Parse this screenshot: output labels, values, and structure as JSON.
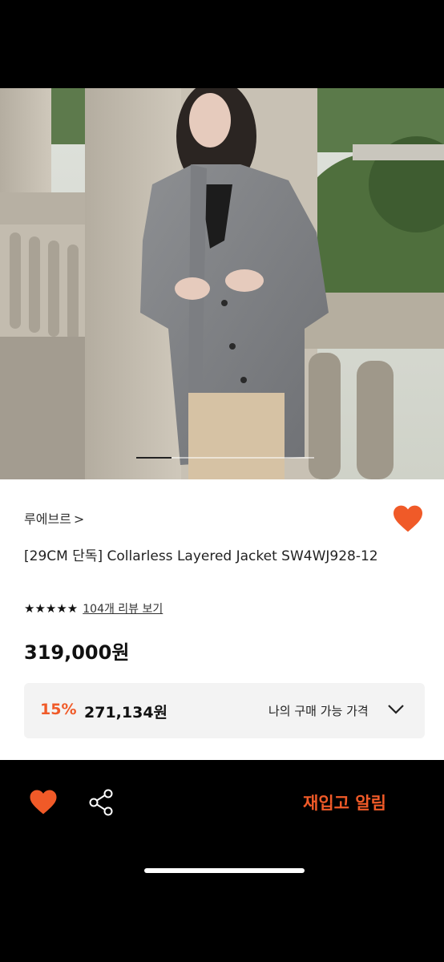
{
  "product": {
    "brand": "루에브르",
    "brand_chevron": ">",
    "title": "[29CM 단독] Collarless Layered Jacket SW4WJ928-12",
    "stars": "★★★★★",
    "review_link": "104개 리뷰 보기",
    "price": "319,000원"
  },
  "gallery": {
    "progress": 0.2
  },
  "discount": {
    "percent": "15%",
    "price": "271,134원",
    "label": "나의 구매 가능 가격"
  },
  "bottom_bar": {
    "restock_label": "재입고 알림"
  },
  "colors": {
    "accent": "#f05a28",
    "text": "#222222",
    "box_bg": "#f3f3f3"
  },
  "icons": {
    "heart": "heart-icon",
    "share": "share-icon",
    "chevron": "chevron-down-icon"
  }
}
